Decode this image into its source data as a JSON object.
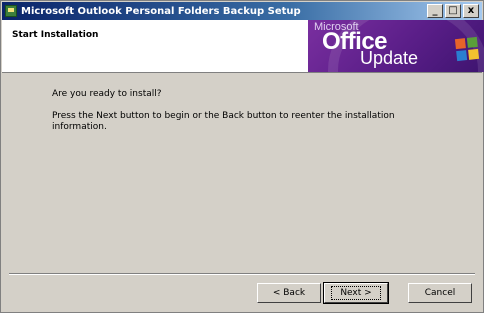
{
  "window": {
    "title": "Microsoft Outlook Personal Folders Backup Setup",
    "controls": {
      "minimize": "_",
      "maximize": "□",
      "close": "x"
    }
  },
  "header": {
    "heading": "Start Installation"
  },
  "banner": {
    "line1": "Microsoft",
    "line2": "Office",
    "line3": "Update"
  },
  "content": {
    "question": "Are you ready to install?",
    "instructions": "Press the Next button to begin or the Back button to reenter the installation information."
  },
  "buttons": {
    "back": "< Back",
    "next": "Next >",
    "cancel": "Cancel"
  },
  "icons": {
    "app": "setup-icon",
    "logo": "office-logo-icon"
  }
}
